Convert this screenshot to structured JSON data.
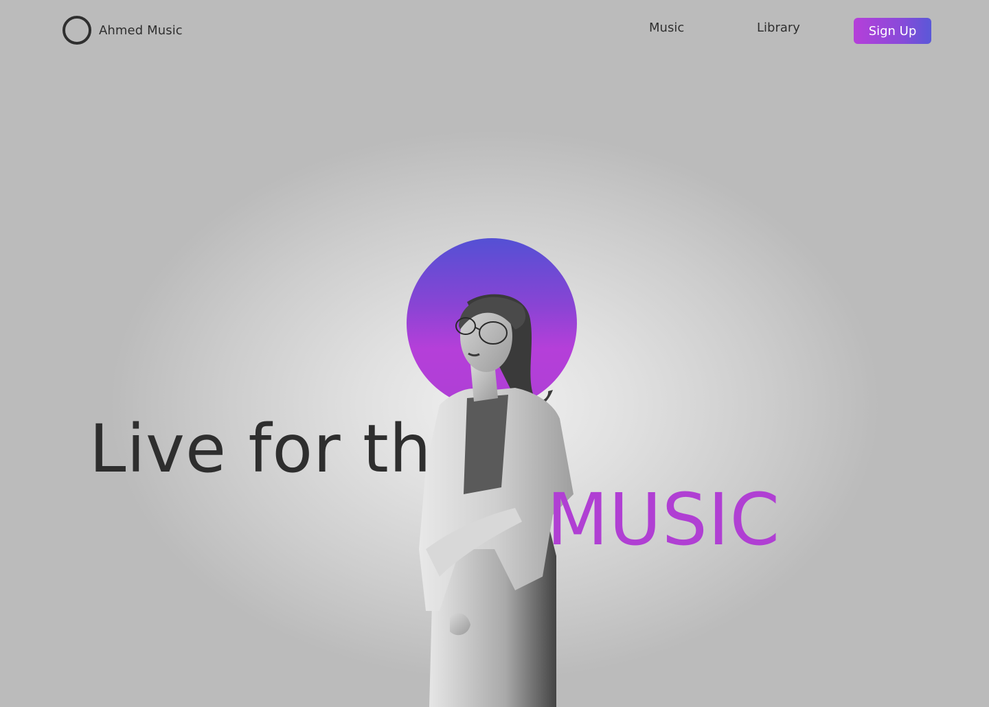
{
  "brand": {
    "name": "Ahmed Music",
    "logo_icon": "circle-ring-icon"
  },
  "nav": {
    "links": [
      "Music",
      "Library"
    ],
    "signup_label": "Sign Up"
  },
  "hero": {
    "headline_line1": "Live for the",
    "headline_line2": "MUSIC",
    "photo": "woman-portrait-grayscale-image"
  },
  "colors": {
    "accent": "#b03fd3",
    "accent_secondary": "#5450d4",
    "text": "#2e2e2e",
    "background": "#bbbbbb"
  }
}
